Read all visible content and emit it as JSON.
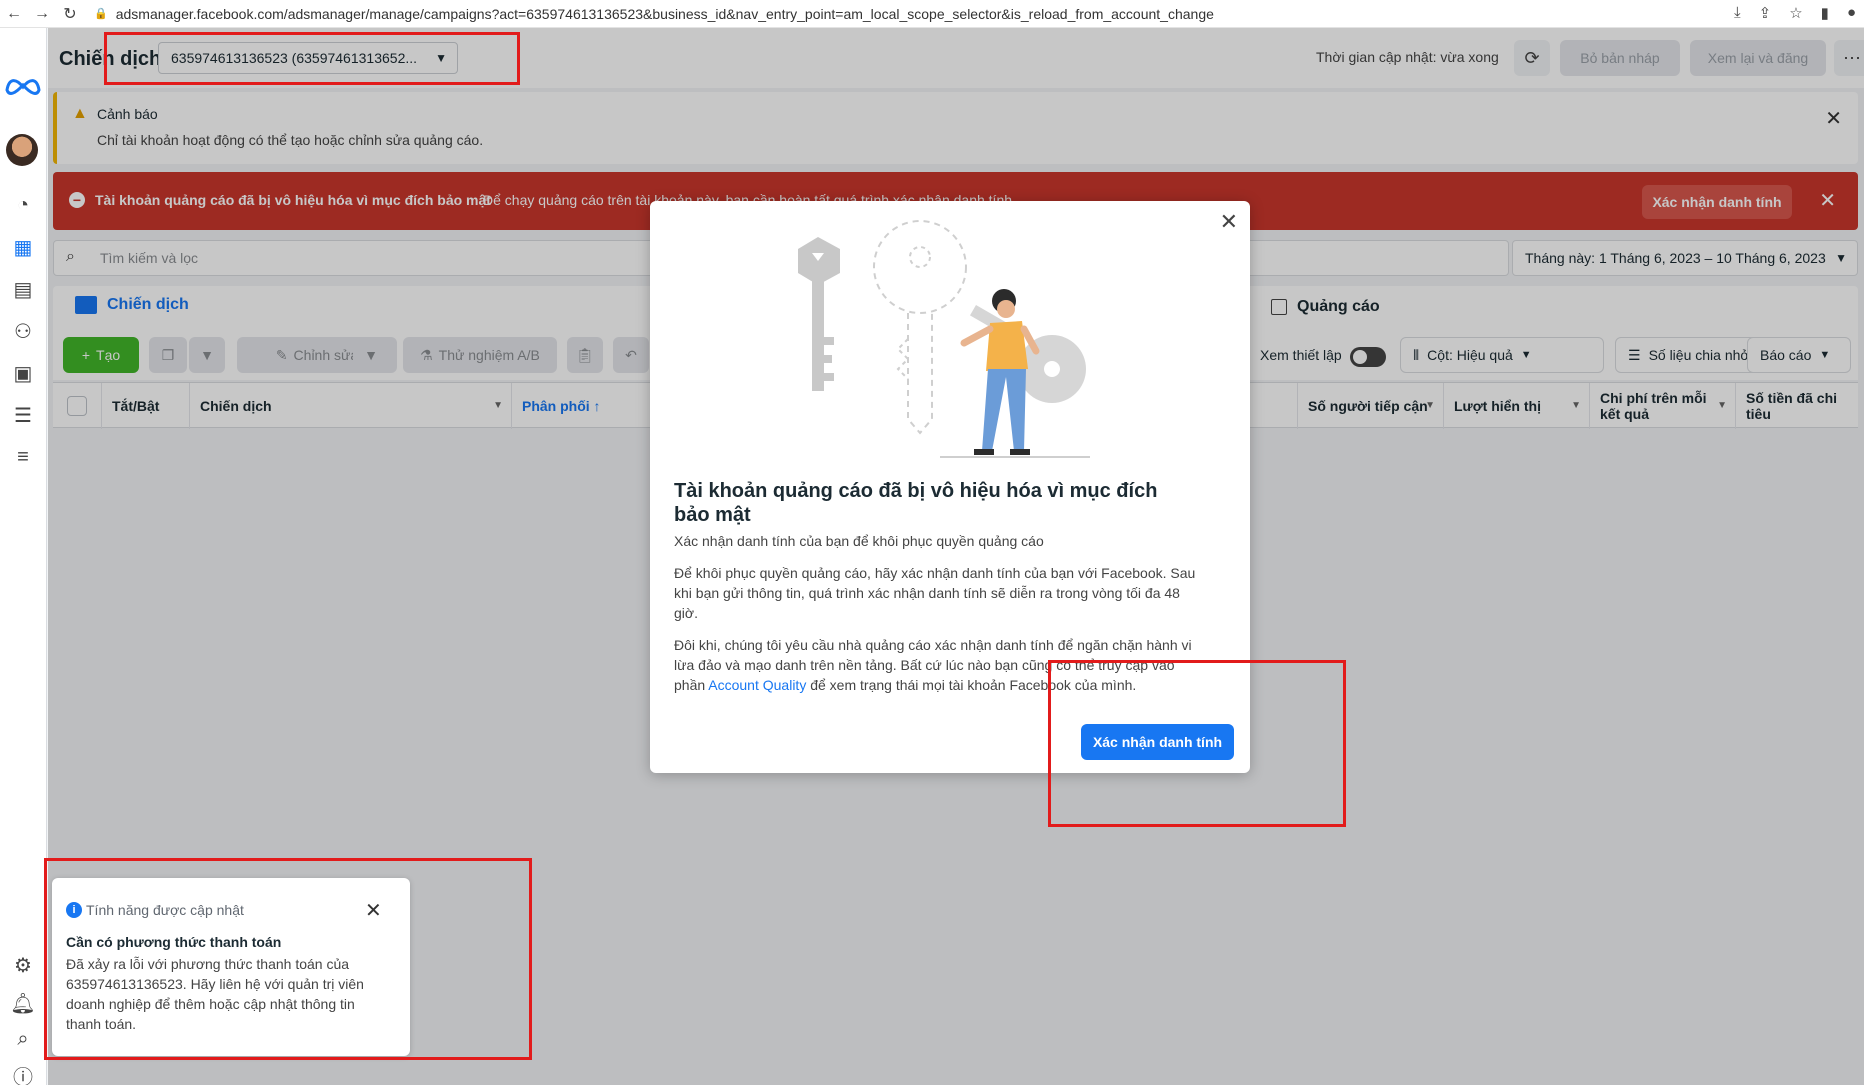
{
  "browser": {
    "url": "adsmanager.facebook.com/adsmanager/manage/campaigns?act=635974613136523&business_id&nav_entry_point=am_local_scope_selector&is_reload_from_account_change"
  },
  "header": {
    "title": "Chiến dịch",
    "account_select": "635974613136523 (63597461313652...",
    "update_status": "Thời gian cập nhật: vừa xong",
    "discard_draft": "Bỏ bản nháp",
    "review_publish": "Xem lại và đăng"
  },
  "warning": {
    "title": "Cảnh báo",
    "text": "Chỉ tài khoản hoạt động có thể tạo hoặc chỉnh sửa quảng cáo."
  },
  "red_banner": {
    "title": "Tài khoản quảng cáo đã bị vô hiệu hóa vì mục đích bảo mật",
    "text": "Để chạy quảng cáo trên tài khoản này, bạn cần hoàn tất quá trình xác nhận danh tính.",
    "button": "Xác nhận danh tính"
  },
  "search": {
    "placeholder": "Tìm kiếm và lọc",
    "date_range": "Tháng này: 1 Tháng 6, 2023 – 10 Tháng 6, 2023"
  },
  "tabs": {
    "campaign": "Chiến dịch",
    "ads": "Quảng cáo"
  },
  "toolbar": {
    "create": "Tạo",
    "edit": "Chỉnh sửa",
    "ab_test": "Thử nghiệm A/B",
    "view_setup": "Xem thiết lập",
    "columns": "Cột: Hiệu quả",
    "breakdown": "Số liệu chia nhỏ",
    "reports": "Báo cáo"
  },
  "table": {
    "columns": {
      "toggle": "Tắt/Bật",
      "campaign": "Chiến dịch",
      "delivery": "Phân phối ↑",
      "reach": "Số người tiếp cận",
      "impressions": "Lượt hiển thị",
      "cost_per_result": "Chi phí trên mỗi kết quả",
      "amount_spent": "Số tiền đã chi tiêu"
    }
  },
  "modal": {
    "title": "Tài khoản quảng cáo đã bị vô hiệu hóa vì mục đích bảo mật",
    "subtitle": "Xác nhận danh tính của bạn để khôi phục quyền quảng cáo",
    "para1": "Để khôi phục quyền quảng cáo, hãy xác nhận danh tính của bạn với Facebook. Sau khi bạn gửi thông tin, quá trình xác nhận danh tính sẽ diễn ra trong vòng tối đa 48 giờ.",
    "para2_before": "Đôi khi, chúng tôi yêu cầu nhà quảng cáo xác nhận danh tính để ngăn chặn hành vi lừa đảo và mạo danh trên nền tảng. Bất cứ lúc nào bạn cũng có thể truy cập vào phần ",
    "para2_link": "Account Quality",
    "para2_after": " để xem trạng thái mọi tài khoản Facebook của mình.",
    "button": "Xác nhận danh tính"
  },
  "notification": {
    "header": "Tính năng được cập nhật",
    "title": "Cần có phương thức thanh toán",
    "body": "Đã xảy ra lỗi với phương thức thanh toán của 635974613136523. Hãy liên hệ với quản trị viên doanh nghiệp để thêm hoặc cập nhật thông tin thanh toán."
  },
  "colors": {
    "primary": "#1877f2",
    "danger": "#c9362c",
    "warning": "#f2b705",
    "annotation": "#e21b1b"
  }
}
